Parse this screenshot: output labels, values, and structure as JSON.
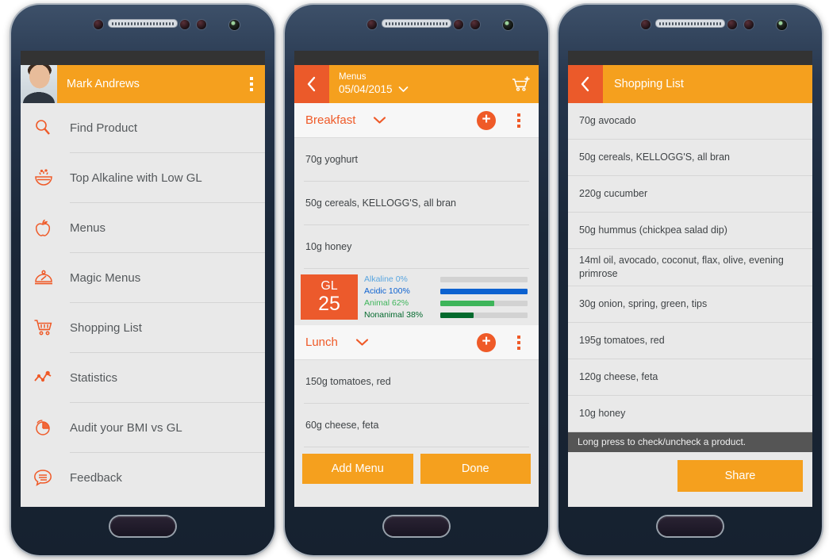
{
  "phone1": {
    "header": {
      "user_name": "Mark Andrews",
      "avatar": "user-photo",
      "overflow": "kebab-menu-icon"
    },
    "drawer_items": [
      {
        "label": "Find Product",
        "icon": "magnifier-icon"
      },
      {
        "label": "Top Alkaline with Low GL",
        "icon": "bowl-icon"
      },
      {
        "label": "Menus",
        "icon": "apple-icon"
      },
      {
        "label": "Magic Menus",
        "icon": "cloche-icon"
      },
      {
        "label": "Shopping List",
        "icon": "cart-icon"
      },
      {
        "label": "Statistics",
        "icon": "line-chart-icon"
      },
      {
        "label": "Audit your BMI vs GL",
        "icon": "pie-chart-icon"
      },
      {
        "label": "Feedback",
        "icon": "speech-bubble-icon"
      }
    ]
  },
  "phone2": {
    "header": {
      "back": "back-arrow-icon",
      "title": "Menus",
      "date": "05/04/2015",
      "date_chevron": "chevron-down-icon",
      "cart": "add-to-cart-icon"
    },
    "sections": [
      {
        "name": "Breakfast",
        "chevron": "chevron-down-icon",
        "add": "add-icon",
        "overflow": "kebab-menu-icon",
        "items": [
          "70g yoghurt",
          "50g cereals, KELLOGG'S, all bran",
          "10g honey"
        ],
        "gl": {
          "label": "GL",
          "value": "25",
          "rows": [
            {
              "label": "Alkaline 0%",
              "percent": 0,
              "color": "#5aa6e0",
              "text_color": "#5aa6e0"
            },
            {
              "label": "Acidic 100%",
              "percent": 100,
              "color": "#0d62d0",
              "text_color": "#0d62d0"
            },
            {
              "label": "Animal 62%",
              "percent": 62,
              "color": "#3eb55a",
              "text_color": "#3eb55a"
            },
            {
              "label": "Nonanimal 38%",
              "percent": 38,
              "color": "#046a2e",
              "text_color": "#046a2e"
            }
          ]
        }
      },
      {
        "name": "Lunch",
        "chevron": "chevron-down-icon",
        "add": "add-icon",
        "overflow": "kebab-menu-icon",
        "items": [
          "150g tomatoes, red",
          "60g cheese, feta"
        ]
      }
    ],
    "buttons": {
      "add_menu": "Add Menu",
      "done": "Done"
    }
  },
  "phone3": {
    "header": {
      "back": "back-arrow-icon",
      "title": "Shopping List"
    },
    "items": [
      "70g avocado",
      "50g cereals, KELLOGG'S, all bran",
      "220g cucumber",
      "50g hummus (chickpea salad dip)",
      "14ml oil, avocado, coconut, flax, olive, evening primrose",
      "30g onion, spring, green, tips",
      "195g tomatoes, red",
      "120g cheese, feta",
      "10g honey"
    ],
    "toast": "Long press to check/uncheck a product.",
    "share_button": "Share"
  },
  "theme": {
    "orange": "#f5a01e",
    "orange_dark": "#eb5a2a",
    "accent": "#ef5a28",
    "screen_bg": "#e9e9e9",
    "status_bar": "#333333"
  }
}
